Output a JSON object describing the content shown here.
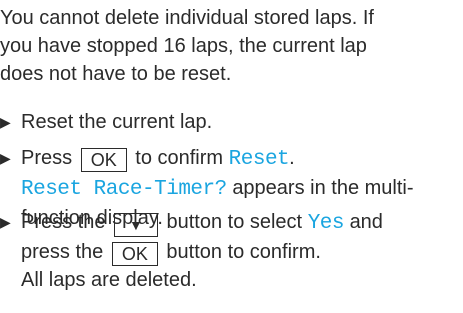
{
  "intro": {
    "lines": [
      "You cannot delete individual stored laps. If",
      "you have stopped 16 laps, the current lap",
      "does not have to be reset."
    ]
  },
  "steps": {
    "step1": {
      "arrow": "▶",
      "text": "Reset the current lap."
    },
    "step2": {
      "arrow": "▶",
      "press": "Press",
      "key_ok": "OK",
      "to_confirm": "to confirm",
      "reset_label": "Reset",
      "period": ".",
      "display_msg": "Reset Race-Timer?",
      "appears": "appears in the multi-",
      "function_display": "function display."
    },
    "step3": {
      "arrow": "▶",
      "press": "Press the",
      "key_down": "▼",
      "button_select": "button to select",
      "yes_label": "Yes",
      "and": "and",
      "press_the": "press the",
      "key_ok": "OK",
      "button_confirm": "button to confirm.",
      "result": "All laps are deleted."
    }
  },
  "colors": {
    "display_text": "#1aa5e0",
    "body_text": "#2b2b2b"
  }
}
